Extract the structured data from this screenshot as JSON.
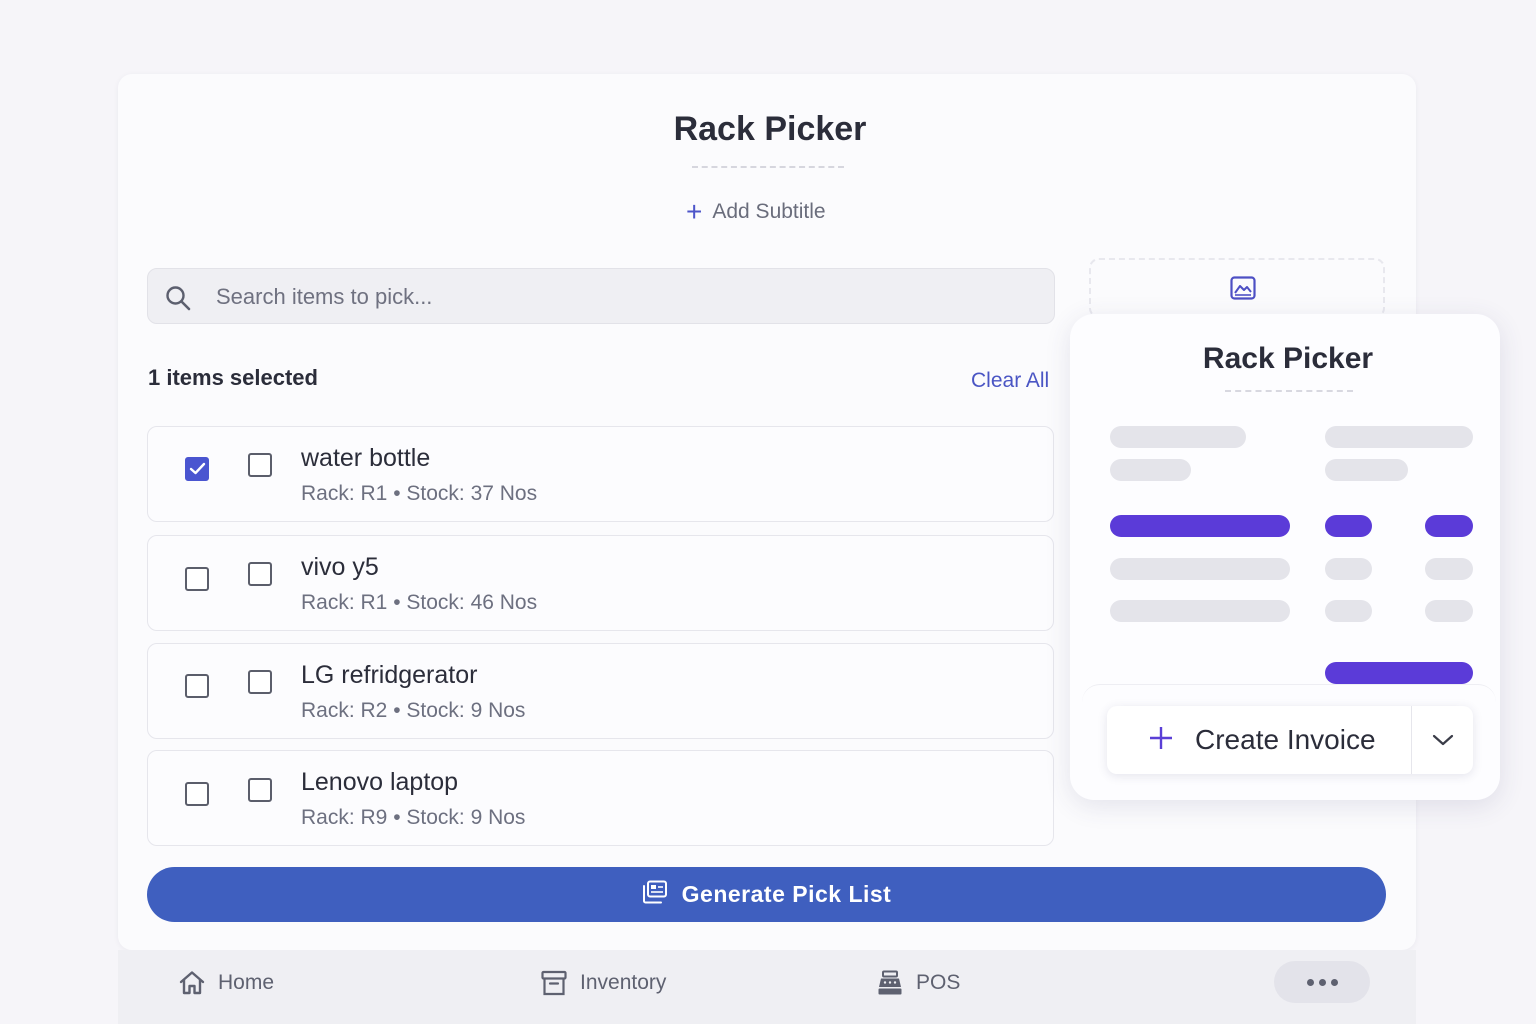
{
  "header": {
    "title": "Rack Picker",
    "add_subtitle_label": "Add Subtitle"
  },
  "search": {
    "placeholder": "Search items to pick..."
  },
  "selection": {
    "count_label": "1 items selected",
    "clear_all_label": "Clear All"
  },
  "items": [
    {
      "name": "water bottle",
      "meta": "Rack: R1 • Stock: 37 Nos",
      "checked": true
    },
    {
      "name": "vivo y5",
      "meta": "Rack: R1 • Stock: 46 Nos",
      "checked": false
    },
    {
      "name": "LG refridgerator",
      "meta": "Rack: R2 • Stock: 9 Nos",
      "checked": false
    },
    {
      "name": "Lenovo laptop",
      "meta": "Rack: R9 • Stock: 9 Nos",
      "checked": false
    }
  ],
  "preview": {
    "title": "Rack Picker",
    "create_invoice_label": "Create Invoice"
  },
  "actions": {
    "generate_label": "Generate Pick List"
  },
  "bottom_nav": {
    "home": "Home",
    "inventory": "Inventory",
    "pos": "POS"
  },
  "colors": {
    "accent": "#3f5fbf",
    "checkbox_checked": "#4a55d0",
    "preview_accent": "#5b3bd8",
    "link": "#4a55c4"
  },
  "icons": {
    "search": "search-icon",
    "image": "image-icon",
    "generate": "pick-list-icon",
    "home": "home-icon",
    "inventory": "archive-box-icon",
    "pos": "cash-register-icon",
    "more": "more-dots-icon"
  }
}
